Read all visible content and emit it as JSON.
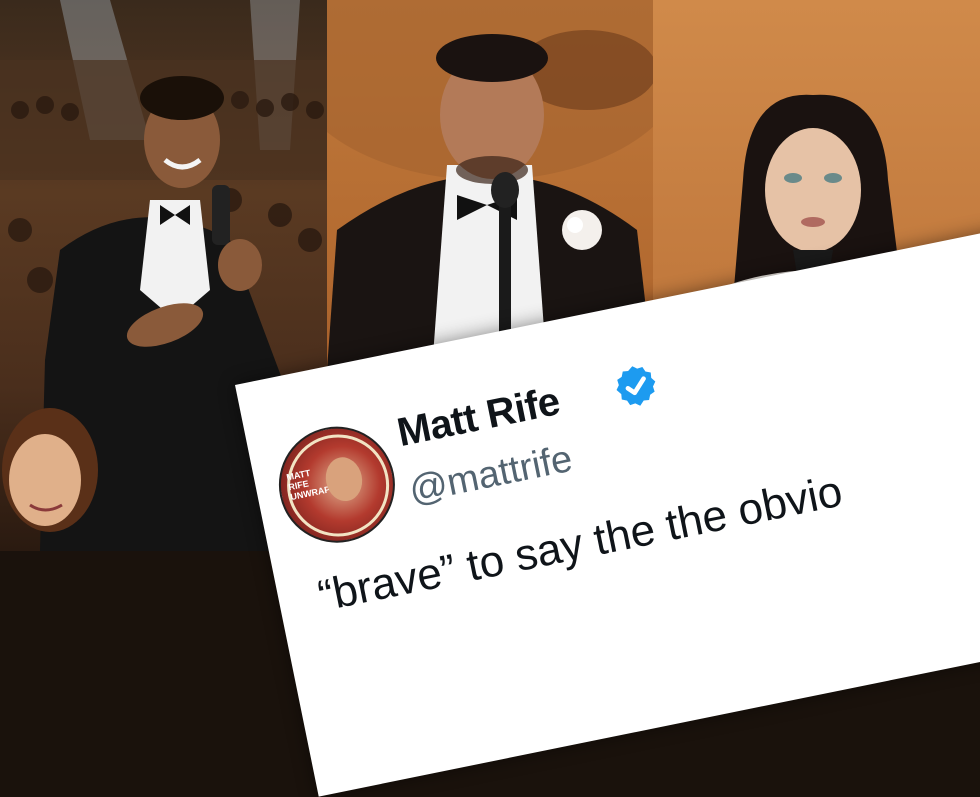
{
  "tweet": {
    "name": "Matt Rife",
    "handle": "@mattrife",
    "text": "“brave” to say the the obvio",
    "avatar_text": "MATT RIFE UNWRAPPED"
  },
  "colors": {
    "verified": "#1d9bf0",
    "card_bg": "#ffffff",
    "name": "#0f1419",
    "handle": "#536471"
  },
  "panels": [
    {
      "scene": "host with microphone in audience"
    },
    {
      "scene": "presenter in velvet tuxedo at microphone"
    },
    {
      "scene": "presenter at podium"
    }
  ]
}
